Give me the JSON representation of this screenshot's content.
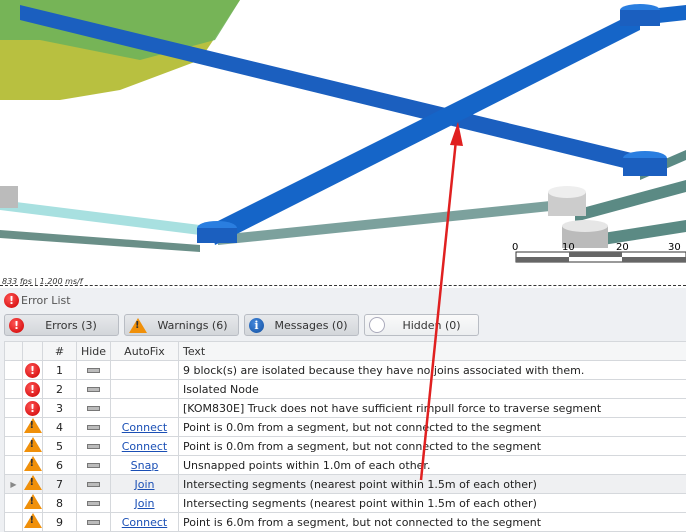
{
  "viewport": {
    "fps_text": "833 fps | 1.200 ms/f",
    "scale_ticks": [
      "0",
      "10",
      "20",
      "30"
    ]
  },
  "error_list": {
    "title": "Error List",
    "filters": [
      {
        "label": "Errors (3)",
        "icon": "error-icon"
      },
      {
        "label": "Warnings (6)",
        "icon": "warning-icon"
      },
      {
        "label": "Messages (0)",
        "icon": "info-icon"
      },
      {
        "label": "Hidden (0)",
        "icon": "hidden-icon"
      }
    ],
    "columns": [
      "",
      "#",
      "Hide",
      "AutoFix",
      "Text"
    ],
    "rows": [
      {
        "type": "error",
        "num": "1",
        "autofix": "",
        "text": "9 block(s) are isolated because they have no joins associated with them."
      },
      {
        "type": "error",
        "num": "2",
        "autofix": "",
        "text": "Isolated Node"
      },
      {
        "type": "error",
        "num": "3",
        "autofix": "",
        "text": "[KOM830E] Truck does not have sufficient rimpull force to traverse segment"
      },
      {
        "type": "warning",
        "num": "4",
        "autofix": "Connect",
        "text": "Point is 0.0m from a segment, but not connected to the segment"
      },
      {
        "type": "warning",
        "num": "5",
        "autofix": "Connect",
        "text": "Point is 0.0m from a segment, but not connected to the segment"
      },
      {
        "type": "warning",
        "num": "6",
        "autofix": "Snap",
        "text": "Unsnapped points within 1.0m of each other."
      },
      {
        "type": "warning",
        "num": "7",
        "autofix": "Join",
        "text": "Intersecting segments (nearest point within 1.5m of each other)"
      },
      {
        "type": "warning",
        "num": "8",
        "autofix": "Join",
        "text": "Intersecting segments (nearest point within 1.5m of each other)"
      },
      {
        "type": "warning",
        "num": "9",
        "autofix": "Connect",
        "text": "Point is 6.0m from a segment, but not connected to the segment"
      }
    ]
  }
}
